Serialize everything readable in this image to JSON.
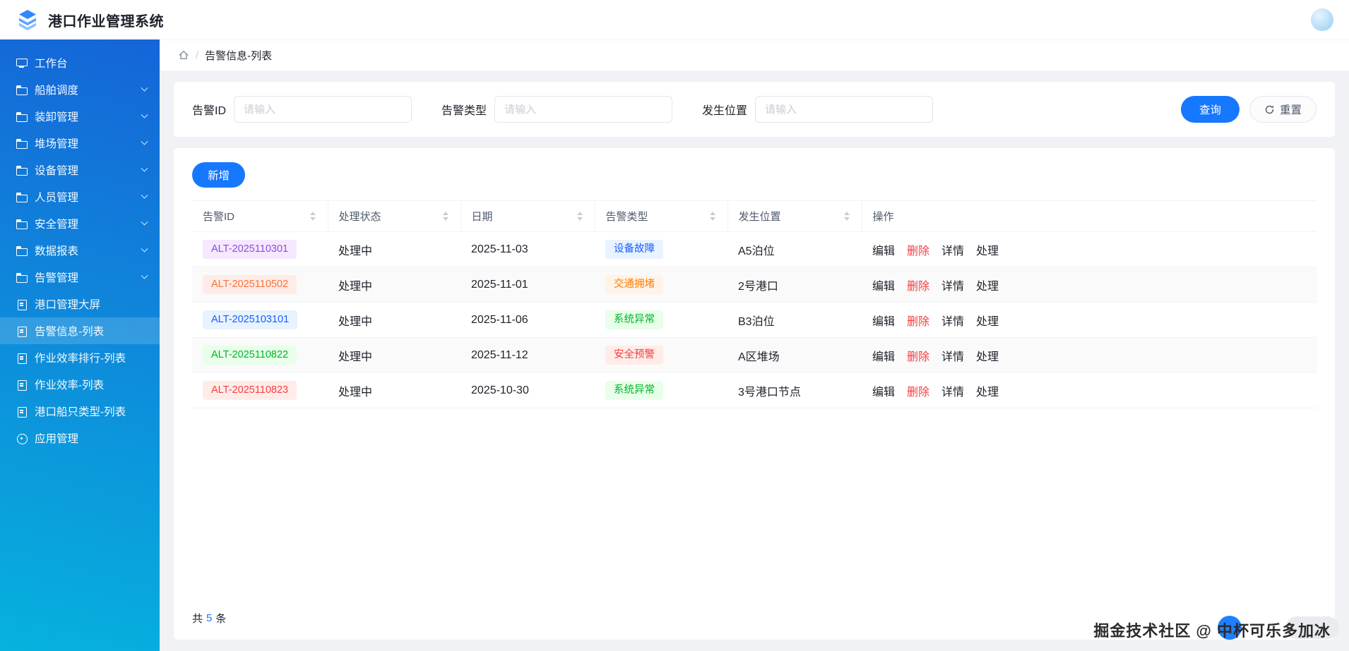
{
  "app": {
    "title": "港口作业管理系统"
  },
  "header": {
    "avatar": "user-avatar"
  },
  "sidebar": {
    "items": [
      {
        "label": "工作台",
        "icon": "desktop"
      },
      {
        "label": "船舶调度",
        "icon": "folder",
        "expandable": true
      },
      {
        "label": "装卸管理",
        "icon": "folder",
        "expandable": true
      },
      {
        "label": "堆场管理",
        "icon": "folder",
        "expandable": true
      },
      {
        "label": "设备管理",
        "icon": "folder",
        "expandable": true
      },
      {
        "label": "人员管理",
        "icon": "folder",
        "expandable": true
      },
      {
        "label": "安全管理",
        "icon": "folder",
        "expandable": true
      },
      {
        "label": "数据报表",
        "icon": "folder",
        "expandable": true
      },
      {
        "label": "告警管理",
        "icon": "folder",
        "expandable": true
      },
      {
        "label": "港口管理大屏",
        "icon": "doc"
      },
      {
        "label": "告警信息-列表",
        "icon": "doc",
        "active": true
      },
      {
        "label": "作业效率排行-列表",
        "icon": "doc"
      },
      {
        "label": "作业效率-列表",
        "icon": "doc"
      },
      {
        "label": "港口船只类型-列表",
        "icon": "doc"
      },
      {
        "label": "应用管理",
        "icon": "app"
      }
    ]
  },
  "breadcrumb": {
    "separator": "/",
    "current": "告警信息-列表"
  },
  "filters": {
    "fields": [
      {
        "label": "告警ID",
        "placeholder": "请输入"
      },
      {
        "label": "告警类型",
        "placeholder": "请输入"
      },
      {
        "label": "发生位置",
        "placeholder": "请输入"
      }
    ],
    "search_label": "查询",
    "reset_label": "重置"
  },
  "toolbar": {
    "add_label": "新增"
  },
  "table": {
    "columns": [
      {
        "label": "告警ID",
        "sortable": true
      },
      {
        "label": "处理状态",
        "sortable": true
      },
      {
        "label": "日期",
        "sortable": true
      },
      {
        "label": "告警类型",
        "sortable": true
      },
      {
        "label": "发生位置",
        "sortable": true
      },
      {
        "label": "操作",
        "sortable": false
      }
    ],
    "rows": [
      {
        "id": "ALT-2025110301",
        "id_tone": "purple",
        "status": "处理中",
        "date": "2025-11-03",
        "type": "设备故障",
        "type_tone": "blue",
        "location": "A5泊位"
      },
      {
        "id": "ALT-2025110502",
        "id_tone": "orangered",
        "status": "处理中",
        "date": "2025-11-01",
        "type": "交通拥堵",
        "type_tone": "orange",
        "location": "2号港口"
      },
      {
        "id": "ALT-2025103101",
        "id_tone": "blue",
        "status": "处理中",
        "date": "2025-11-06",
        "type": "系统异常",
        "type_tone": "green",
        "location": "B3泊位"
      },
      {
        "id": "ALT-2025110822",
        "id_tone": "green",
        "status": "处理中",
        "date": "2025-11-12",
        "type": "安全预警",
        "type_tone": "red",
        "location": "A区堆场"
      },
      {
        "id": "ALT-2025110823",
        "id_tone": "red",
        "status": "处理中",
        "date": "2025-10-30",
        "type": "系统异常",
        "type_tone": "green",
        "location": "3号港口节点"
      }
    ],
    "actions": [
      "编辑",
      "删除",
      "详情",
      "处理"
    ],
    "total": {
      "prefix": "共",
      "count": "5",
      "suffix": "条"
    }
  },
  "watermark": {
    "text": "掘金技术社区 @ 中杯可乐多加冰"
  },
  "colors": {
    "accent": "#1677ff",
    "danger": "#f53f3f",
    "sidebar_gradient_top": "#1565d8",
    "sidebar_gradient_bottom": "#06b2de",
    "page_background": "#f0f2f5"
  }
}
